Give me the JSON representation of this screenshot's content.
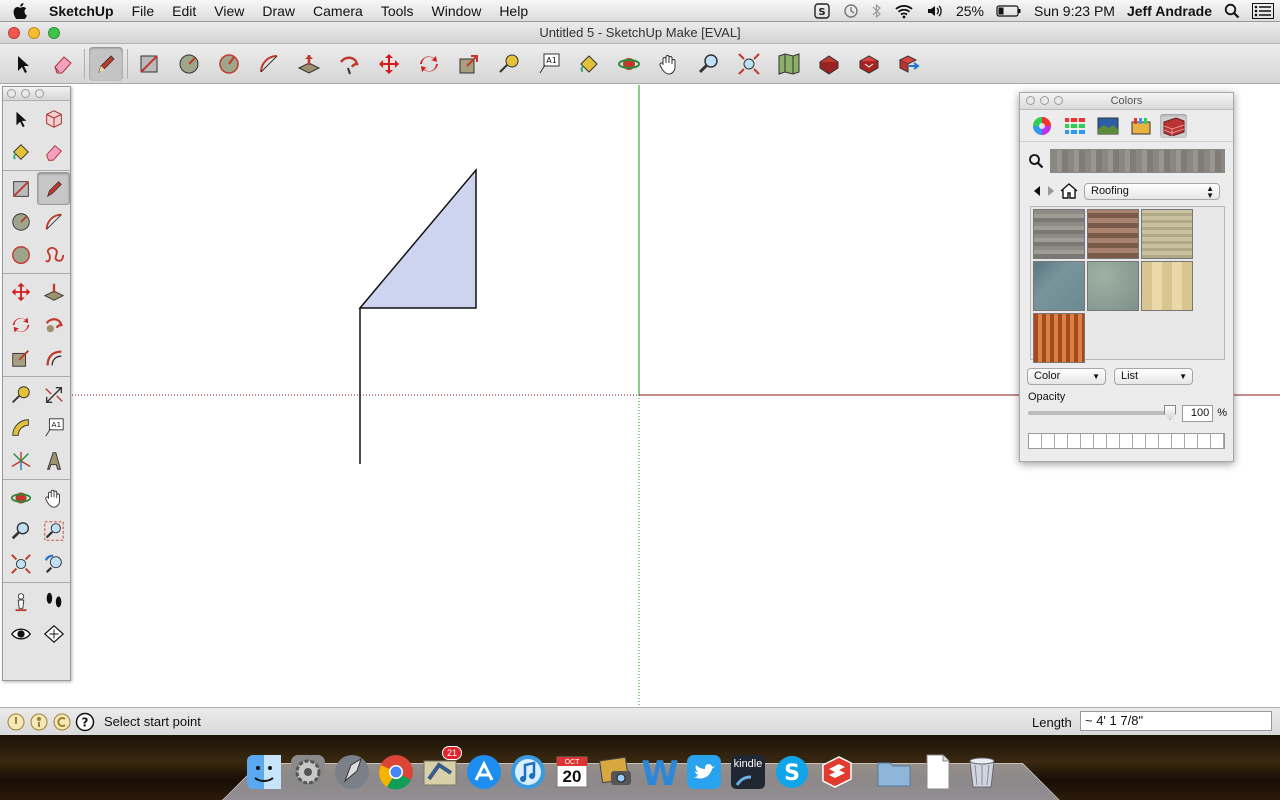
{
  "menubar": {
    "app_name": "SketchUp",
    "items": [
      "File",
      "Edit",
      "View",
      "Draw",
      "Camera",
      "Tools",
      "Window",
      "Help"
    ],
    "battery": "25%",
    "clock": "Sun 9:23 PM",
    "user": "Jeff Andrade"
  },
  "window": {
    "title": "Untitled 5 - SketchUp Make [EVAL]"
  },
  "colors_panel": {
    "title": "Colors",
    "collection": "Roofing",
    "mode_dropdown": "Color",
    "view_dropdown": "List",
    "opacity_label": "Opacity",
    "opacity_value": "100",
    "opacity_unit": "%"
  },
  "statusbar": {
    "message": "Select start point",
    "length_label": "Length",
    "length_value": "~ 4' 1 7/8\""
  },
  "dock": {
    "mail_badge": "21",
    "calendar_month": "OCT",
    "calendar_day": "20",
    "kindle_label": "kindle"
  },
  "colors": {
    "axis_red": "#8b1a1a",
    "axis_green": "#1a9a1a",
    "face": "#cdd4f0"
  }
}
